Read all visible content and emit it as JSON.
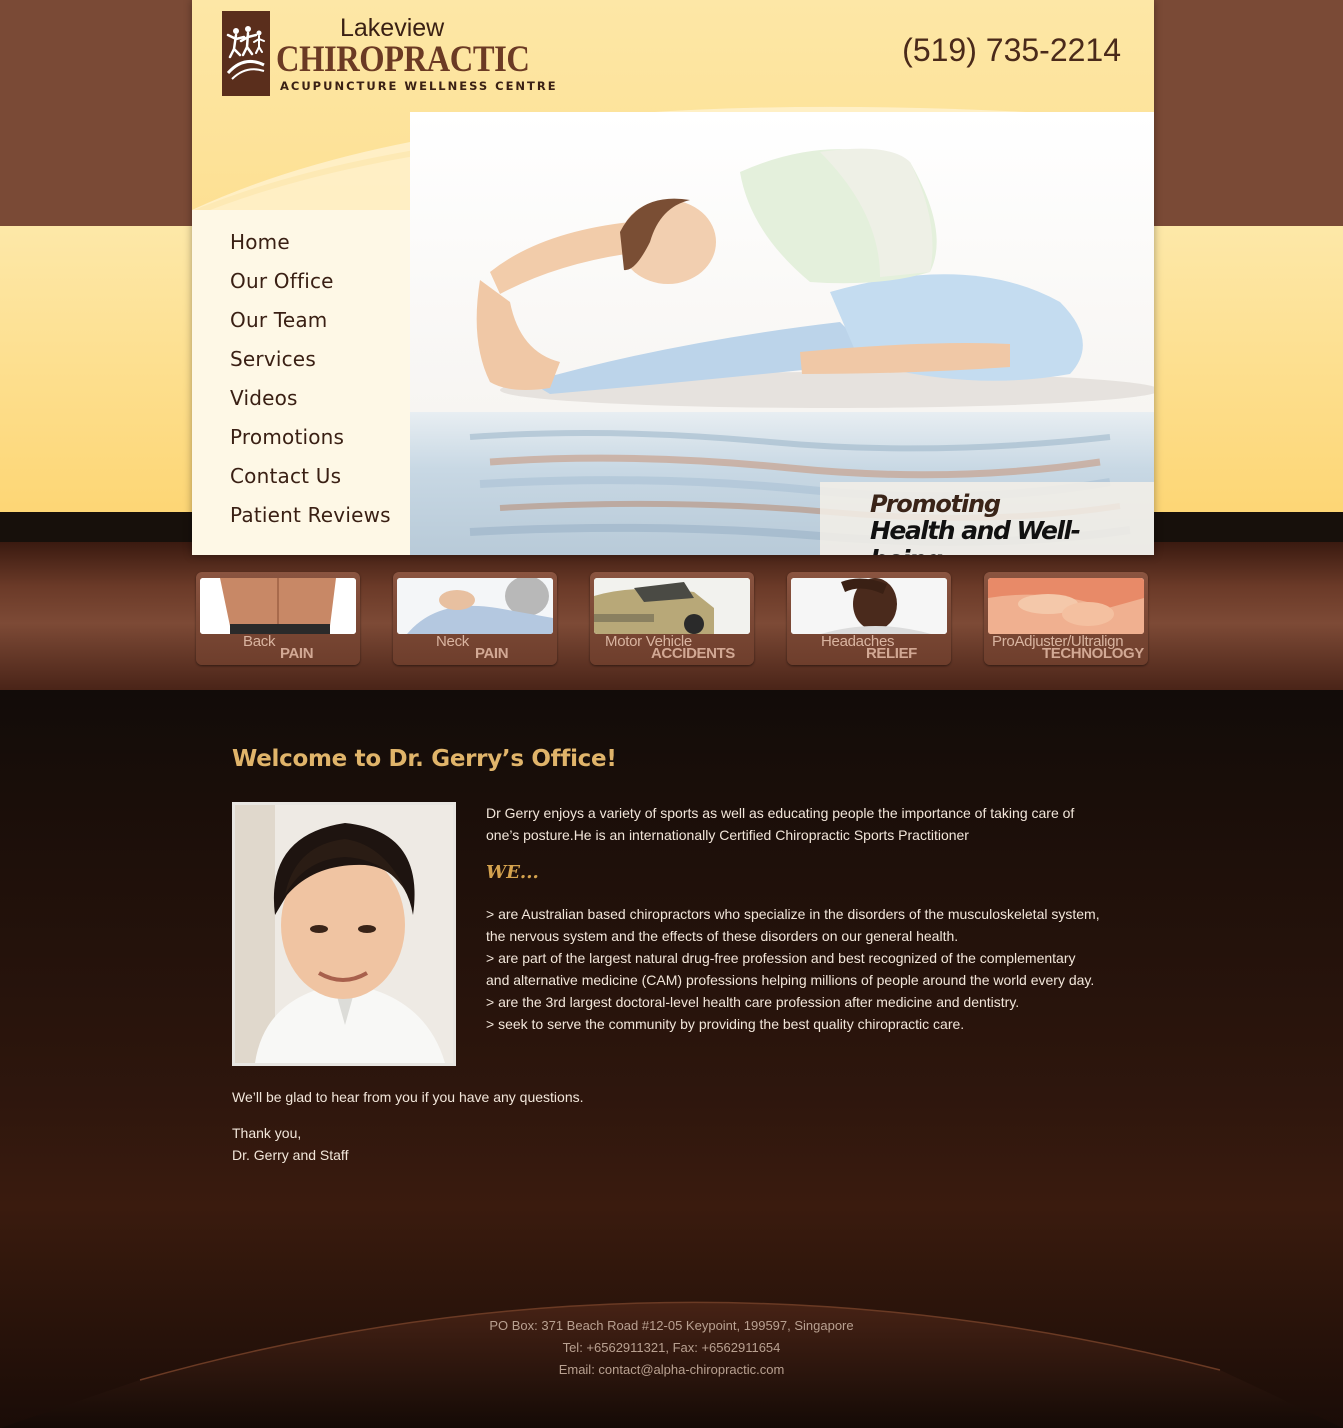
{
  "logo": {
    "line1": "Lakeview",
    "line2": "CHIROPRACTIC",
    "line3": "ACUPUNCTURE WELLNESS CENTRE"
  },
  "header": {
    "phone": "(519) 735-2214"
  },
  "nav": {
    "items": [
      {
        "label": "Home"
      },
      {
        "label": "Our Office"
      },
      {
        "label": "Our Team"
      },
      {
        "label": "Services"
      },
      {
        "label": "Videos"
      },
      {
        "label": "Promotions"
      },
      {
        "label": "Contact Us"
      },
      {
        "label": "Patient Reviews"
      }
    ]
  },
  "hero": {
    "tagline1": "Promoting",
    "tagline2": "Health and Well-being..."
  },
  "tiles": [
    {
      "line1": "Back",
      "line2": "PAIN"
    },
    {
      "line1": "Neck",
      "line2": "PAIN"
    },
    {
      "line1": "Motor Vehicle",
      "line2": "ACCIDENTS"
    },
    {
      "line1": "Headaches",
      "line2": "RELIEF"
    },
    {
      "line1": "ProAdjuster/Ultralign",
      "line2": "TECHNOLOGY"
    }
  ],
  "content": {
    "title": "Welcome to Dr. Gerry’s Office!",
    "intro_line1": "Dr Gerry enjoys a variety of sports as well as educating people the importance of taking care of",
    "intro_line2": "one’s posture.He is an internationally Certified Chiropractic Sports Practitioner",
    "we_heading": "WE...",
    "points": [
      "> are Australian based chiropractors who specialize in the disorders of the musculoskeletal system,",
      "the nervous system and the effects of these disorders on our general health.",
      "> are part of the largest natural drug-free profession and best recognized of the complementary",
      "and alternative medicine (CAM) professions helping millions of people around the world every day.",
      "> are the 3rd largest doctoral-level health care profession after medicine and dentistry.",
      "> seek to serve the community by providing the best quality chiropractic care."
    ],
    "closing": "We’ll be glad to hear from you if you have any questions.",
    "thanks": "Thank you,",
    "signature": "Dr. Gerry and Staff"
  },
  "footer": {
    "address": "PO Box: 371 Beach Road #12-05 Keypoint, 199597, Singapore",
    "phone_fax": "Tel: +6562911321, Fax: +6562911654",
    "email": "Email: contact@alpha-chiropractic.com"
  },
  "colors": {
    "brand_brown": "#6b3a24",
    "accent_gold": "#e0b46a",
    "header_yellow": "#fdd575",
    "page_dark": "#2a140c"
  }
}
